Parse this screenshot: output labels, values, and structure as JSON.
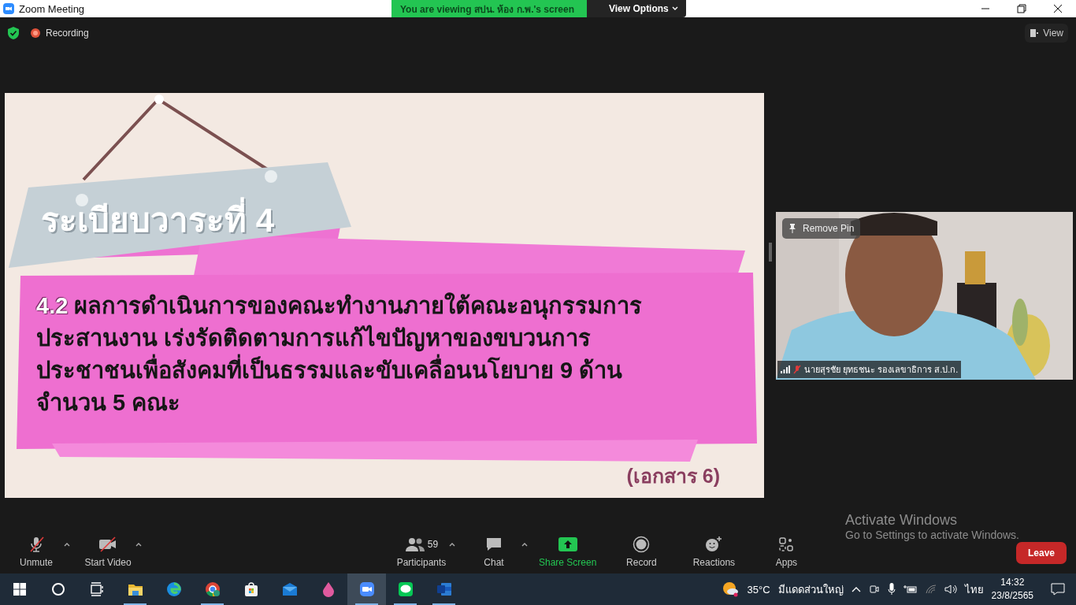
{
  "window": {
    "title": "Zoom Meeting"
  },
  "share_banner": {
    "text": "You are viewing สปน. ห้อง ก.พ.'s screen",
    "button": "View Options"
  },
  "top_bar": {
    "recording": "Recording",
    "view": "View"
  },
  "slide": {
    "heading": "ระเบียบวาระที่ 4",
    "number": "4.2",
    "lines": [
      "ผลการดำเนินการของคณะทำงานภายใต้คณะอนุกรรมการ",
      "ประสานงาน เร่งรัดติดตามการแก้ไขปัญหาของขบวนการ",
      "ประชาชนเพื่อสังคมที่เป็นธรรมและขับเคลื่อนนโยบาย 9 ด้าน",
      "จำนวน 5 คณะ"
    ],
    "note": "(เอกสาร 6)"
  },
  "video": {
    "remove_pin": "Remove Pin",
    "name": "นายสุรชัย ยุทธชนะ รองเลขาธิการ ส.ป.ก.",
    "muted": true
  },
  "toolbar": [
    {
      "kind": "audio",
      "label": "Unmute",
      "muted": true,
      "caret": true
    },
    {
      "kind": "video",
      "label": "Start Video",
      "muted": true,
      "caret": true
    },
    {
      "kind": "participants",
      "label": "Participants",
      "count": "59",
      "caret": true
    },
    {
      "kind": "chat",
      "label": "Chat",
      "caret": true
    },
    {
      "kind": "share",
      "label": "Share Screen",
      "caret": false
    },
    {
      "kind": "record",
      "label": "Record",
      "caret": false
    },
    {
      "kind": "reactions",
      "label": "Reactions",
      "caret": false
    },
    {
      "kind": "apps",
      "label": "Apps",
      "caret": false
    }
  ],
  "leave": "Leave",
  "activation": {
    "title": "Activate Windows",
    "text": "Go to Settings to activate Windows."
  },
  "taskbar": {
    "apps": [
      {
        "kind": "start",
        "running": false,
        "active": false
      },
      {
        "kind": "search",
        "running": false,
        "active": false
      },
      {
        "kind": "taskview",
        "running": false,
        "active": false
      },
      {
        "kind": "folder",
        "running": true,
        "active": false
      },
      {
        "kind": "edge",
        "running": false,
        "active": false
      },
      {
        "kind": "chrome",
        "running": true,
        "active": false
      },
      {
        "kind": "store",
        "running": false,
        "active": false
      },
      {
        "kind": "mail",
        "running": false,
        "active": false
      },
      {
        "kind": "paint",
        "running": false,
        "active": false
      },
      {
        "kind": "zoom",
        "running": true,
        "active": true
      },
      {
        "kind": "line",
        "running": true,
        "active": false
      },
      {
        "kind": "word",
        "running": true,
        "active": false
      }
    ],
    "temperature": "35°C",
    "weather": "มีแดดส่วนใหญ่",
    "language": "ไทย",
    "time": "14:32",
    "date": "23/8/2565"
  }
}
